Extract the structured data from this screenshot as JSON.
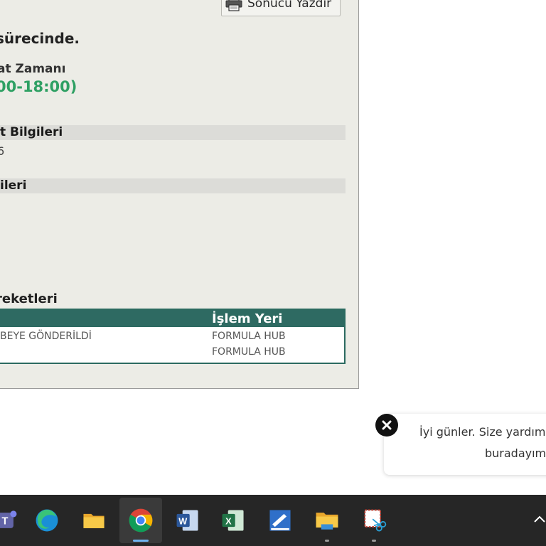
{
  "panel": {
    "print_label": "Sonucu Yazdır",
    "status_text": "sürecinde.",
    "time_label": "at Zamanı",
    "time_value": "00-18:00)",
    "section_info": "t Bilgileri",
    "info_value": "6",
    "section_2": "ileri",
    "moves_title": "reketleri"
  },
  "moves_table": {
    "header_col2": "İşlem Yeri",
    "rows": [
      {
        "col1": "BEYE GÖNDERİLDİ",
        "col2": "FORMULA HUB"
      },
      {
        "col1": "",
        "col2": "FORMULA HUB"
      }
    ]
  },
  "chat": {
    "line1": "İyi günler. Size yardımc",
    "line2": "buradayım"
  },
  "taskbar": {
    "icons": [
      "teams-icon",
      "edge-icon",
      "file-explorer-icon",
      "chrome-icon",
      "word-icon",
      "excel-icon",
      "paint-icon",
      "folder-icon",
      "snipping-tool-icon"
    ]
  },
  "colors": {
    "accent_green": "#2ea063",
    "table_header": "#2e6a62",
    "taskbar_bg": "#262626"
  }
}
